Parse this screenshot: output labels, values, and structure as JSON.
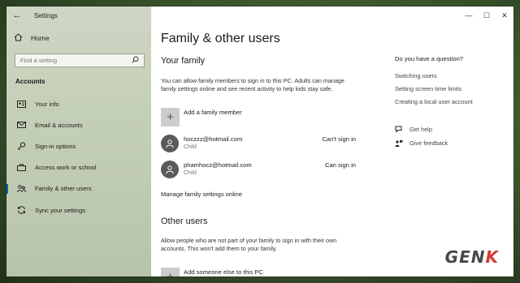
{
  "window": {
    "app_title": "Settings",
    "controls": {
      "minimize": "—",
      "maximize": "☐",
      "close": "✕"
    }
  },
  "sidebar": {
    "back_glyph": "←",
    "home": {
      "label": "Home",
      "icon": "home-icon"
    },
    "search": {
      "placeholder": "Find a setting",
      "icon": "search-icon"
    },
    "section_title": "Accounts",
    "items": [
      {
        "label": "Your info",
        "icon": "person-card-icon",
        "selected": false
      },
      {
        "label": "Email & accounts",
        "icon": "mail-icon",
        "selected": false
      },
      {
        "label": "Sign-in options",
        "icon": "key-icon",
        "selected": false
      },
      {
        "label": "Access work or school",
        "icon": "briefcase-icon",
        "selected": false
      },
      {
        "label": "Family & other users",
        "icon": "people-icon",
        "selected": true
      },
      {
        "label": "Sync your settings",
        "icon": "sync-icon",
        "selected": false
      }
    ]
  },
  "main": {
    "title": "Family & other users",
    "your_family": {
      "heading": "Your family",
      "description": "You can allow family members to sign in to this PC. Adults can manage family settings online and see recent activity to help kids stay safe.",
      "add_member_label": "Add a family member",
      "members": [
        {
          "email": "hoczzz@hotmail.com",
          "role": "Child",
          "status": "Can't sign in"
        },
        {
          "email": "phamhocz@hotmail.com",
          "role": "Child",
          "status": "Can sign in"
        }
      ],
      "manage_link": "Manage family settings online"
    },
    "other_users": {
      "heading": "Other users",
      "description": "Allow people who are not part of your family to sign in with their own accounts. This won't add them to your family.",
      "add_label": "Add someone else to this PC"
    }
  },
  "help": {
    "question": "Do you have a question?",
    "links": [
      "Switching users",
      "Setting screen time limits",
      "Creating a local user account"
    ],
    "get_help": "Get help",
    "give_feedback": "Give feedback"
  },
  "watermark": {
    "part1": "GEN",
    "part2": "K"
  }
}
